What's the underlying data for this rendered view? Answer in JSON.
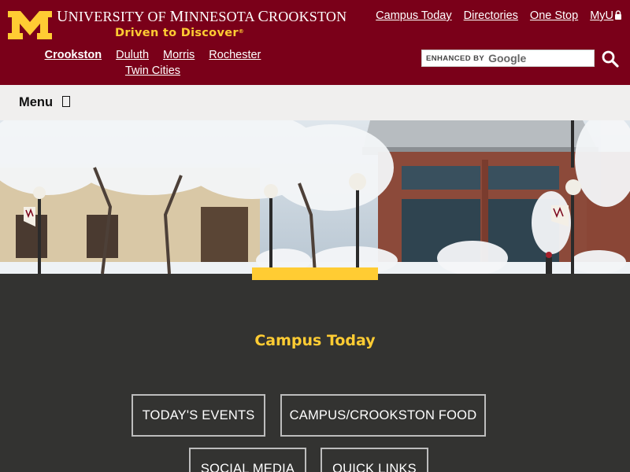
{
  "header": {
    "wordmark_u": "U",
    "wordmark_niversity": "NIVERSITY OF ",
    "wordmark_m": "M",
    "wordmark_innesota": "INNESOTA ",
    "wordmark_c": "C",
    "wordmark_rookston": "ROOKSTON",
    "tagline": "Driven to Discover",
    "tagline_mark": "®",
    "campus_links": [
      "Crookston",
      "Duluth",
      "Morris",
      "Rochester",
      "Twin Cities"
    ],
    "util_links": [
      "Campus Today",
      "Directories",
      "One Stop",
      "MyU"
    ],
    "search": {
      "enhanced_label": "ENHANCED BY",
      "google_label": "Google"
    }
  },
  "menubar": {
    "label": "Menu"
  },
  "section": {
    "title": "Campus Today",
    "buttons": [
      "TODAY'S EVENTS",
      "CAMPUS/CROOKSTON FOOD",
      "SOCIAL MEDIA",
      "QUICK LINKS"
    ]
  },
  "colors": {
    "maroon": "#7a0019",
    "gold": "#ffcc33",
    "dark": "#333331"
  }
}
